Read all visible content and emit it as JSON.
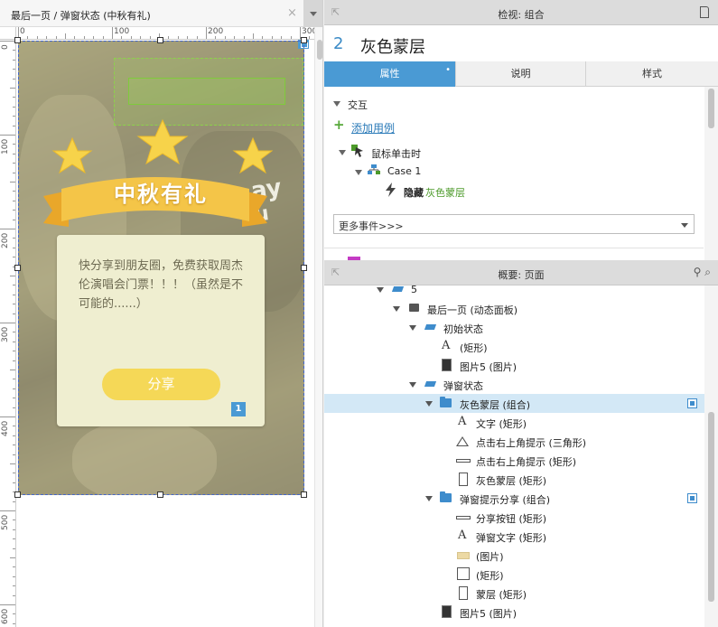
{
  "canvas_tab": {
    "title": "最后一页 / 弹窗状态 (中秋有礼)",
    "close": "×"
  },
  "ruler": {
    "h_labels": [
      "0",
      "100",
      "200",
      "300"
    ],
    "v_labels": [
      "0",
      "100",
      "200",
      "300",
      "400",
      "500",
      "600"
    ]
  },
  "artboard": {
    "ribbon_title": "中秋有礼",
    "card_text": "快分享到朋友圈，免费获取周杰伦演唱会门票！！！（虽然是不可能的......）",
    "share_button": "分享",
    "badge": "1",
    "bg_text_1": "ay",
    "bg_text_2": "u",
    "colors": {
      "star": "#f7d34a",
      "ribbon": "#f4c548",
      "card": "#efeed0",
      "button": "#f5d857",
      "badge": "#4a9ad4"
    }
  },
  "inspector": {
    "header": "检视: 组合",
    "number": "2",
    "name": "灰色蒙层",
    "tabs": [
      {
        "label": "属性",
        "active": true,
        "dot": "•"
      },
      {
        "label": "说明",
        "active": false
      },
      {
        "label": "样式",
        "active": false
      }
    ],
    "section": "交互",
    "add_case": "添加用例",
    "event": "鼠标单击时",
    "case": "Case 1",
    "action": "隐藏",
    "action_target": "灰色蒙层",
    "more_events": "更多事件>>>"
  },
  "outline": {
    "header": "概要: 页面",
    "items": [
      {
        "label": "5",
        "icon": "state"
      },
      {
        "label": "最后一页 (动态面板)",
        "icon": "panel"
      },
      {
        "label": "初始状态",
        "icon": "state"
      },
      {
        "label": "(矩形)",
        "icon": "text"
      },
      {
        "label": "图片5 (图片)",
        "icon": "image"
      },
      {
        "label": "弹窗状态",
        "icon": "state"
      },
      {
        "label": "灰色蒙层 (组合)",
        "icon": "folder",
        "selected": true
      },
      {
        "label": "文字 (矩形)",
        "icon": "text"
      },
      {
        "label": "点击右上角提示 (三角形)",
        "icon": "triangle"
      },
      {
        "label": "点击右上角提示 (矩形)",
        "icon": "rect-line"
      },
      {
        "label": "灰色蒙层 (矩形)",
        "icon": "rect-tall"
      },
      {
        "label": "弹窗提示分享 (组合)",
        "icon": "folder"
      },
      {
        "label": "分享按钮 (矩形)",
        "icon": "rect-line"
      },
      {
        "label": "弹窗文字 (矩形)",
        "icon": "text"
      },
      {
        "label": "(图片)",
        "icon": "image-light"
      },
      {
        "label": "(矩形)",
        "icon": "rect-sq"
      },
      {
        "label": "蒙层 (矩形)",
        "icon": "rect-tall"
      },
      {
        "label": "图片5 (图片)",
        "icon": "image"
      }
    ]
  }
}
